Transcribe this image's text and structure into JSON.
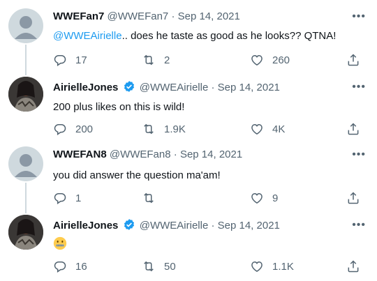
{
  "tweets": [
    {
      "name": "WWEFan7",
      "handle": "@WWEFan7",
      "sep": "·",
      "date": "Sep 14, 2021",
      "mention": "@WWEAirielle",
      "text": ".. does he taste as good as he looks?? QTNA!",
      "replies": "17",
      "retweets": "2",
      "likes": "260",
      "avatar": "default-avatar",
      "verified": false
    },
    {
      "name": "AirielleJones",
      "handle": "@WWEAirielle",
      "sep": "·",
      "date": "Sep 14, 2021",
      "mention": "",
      "text": "200 plus likes on this is wild!",
      "replies": "200",
      "retweets": "1.9K",
      "likes": "4K",
      "avatar": "profile-photo",
      "verified": true
    },
    {
      "name": "WWEFAN8",
      "handle": "@WWEFan8",
      "sep": "·",
      "date": "Sep 14, 2021",
      "mention": "",
      "text": "you did answer the question ma'am!",
      "replies": "1",
      "retweets": "",
      "likes": "9",
      "avatar": "default-avatar",
      "verified": false
    },
    {
      "name": "AirielleJones",
      "handle": "@WWEAirielle",
      "sep": "·",
      "date": "Sep 14, 2021",
      "mention": "",
      "text": "",
      "emoji": "zipper-mouth-face",
      "replies": "16",
      "retweets": "50",
      "likes": "1.1K",
      "avatar": "profile-photo",
      "verified": true
    }
  ],
  "colors": {
    "link": "#1d9bf0",
    "secondary": "#536471",
    "verified": "#1d9bf0",
    "thread_line": "#cfd9de"
  }
}
